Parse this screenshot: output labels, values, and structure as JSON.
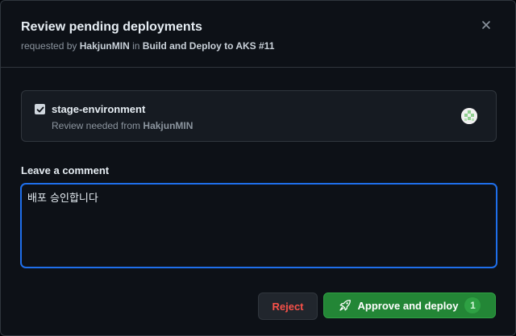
{
  "dialog": {
    "title": "Review pending deployments",
    "subtitle_prefix": "requested by",
    "requester": "HakjunMIN",
    "subtitle_middle": "in",
    "workflow_run": "Build and Deploy to AKS #11",
    "close_icon": "close-icon"
  },
  "environment": {
    "checked": true,
    "name": "stage-environment",
    "review_prefix": "Review needed from",
    "reviewer": "HakjunMIN",
    "avatar_icon": "identicon-avatar"
  },
  "comment": {
    "label": "Leave a comment",
    "value": "배포 승인합니다"
  },
  "actions": {
    "reject_label": "Reject",
    "approve_label": "Approve and deploy",
    "approve_icon": "rocket-icon",
    "approve_count": "1"
  },
  "colors": {
    "background": "#0d1117",
    "border": "#30363d",
    "focus": "#1f6feb",
    "approve": "#238636",
    "reject_text": "#f85149"
  }
}
